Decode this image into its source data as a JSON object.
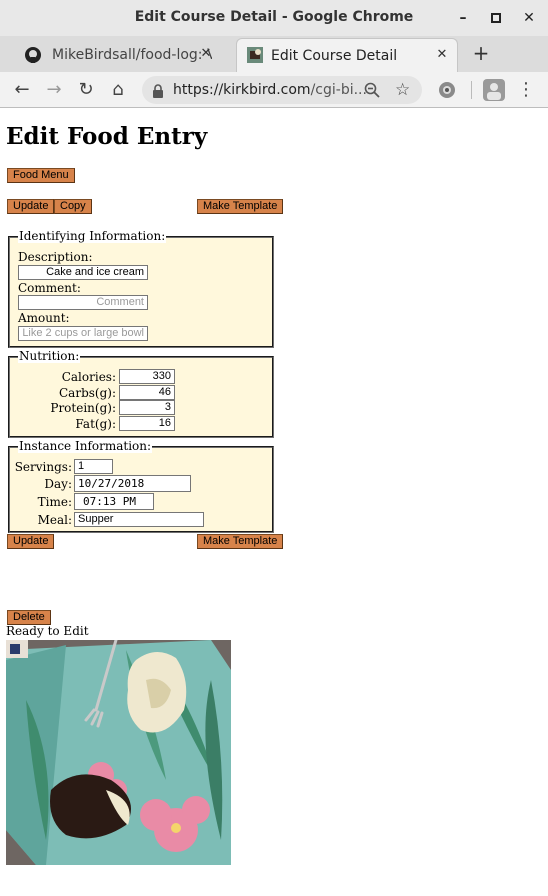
{
  "window": {
    "title": "Edit Course Detail - Google Chrome",
    "minimize": "–",
    "maximize": "▫",
    "close": "✕"
  },
  "tabs": [
    {
      "label": "MikeBirdsall/food-log: V",
      "close": "✕"
    },
    {
      "label": "Edit Course Detail",
      "close": "✕"
    }
  ],
  "toolbar": {
    "new_tab": "+",
    "back": "←",
    "forward": "→",
    "reload": "↻",
    "home": "⌂",
    "url_host": "https://kirkbird.com",
    "url_path": "/cgi-bi...",
    "star": "☆",
    "menu": "⋮"
  },
  "page": {
    "heading": "Edit Food Entry",
    "food_menu_button": "Food Menu",
    "update_button": "Update",
    "copy_button": "Copy",
    "make_template_button": "Make Template",
    "identifying": {
      "legend": "Identifying Information:",
      "description_label": "Description:",
      "description_value": "Cake and ice cream",
      "comment_label": "Comment:",
      "comment_placeholder": "Comment",
      "amount_label": "Amount:",
      "amount_placeholder": "Like 2 cups or large bowl"
    },
    "nutrition": {
      "legend": "Nutrition:",
      "calories_label": "Calories:",
      "calories_value": "330",
      "carbs_label": "Carbs(g):",
      "carbs_value": "46",
      "protein_label": "Protein(g):",
      "protein_value": "3",
      "fat_label": "Fat(g):",
      "fat_value": "16"
    },
    "instance": {
      "legend": "Instance Information:",
      "servings_label": "Servings:",
      "servings_value": "1",
      "day_label": "Day:",
      "day_value": "10/27/2018",
      "time_label": "Time:",
      "time_value": "07:13 PM",
      "meal_label": "Meal:",
      "meal_value": "Supper"
    },
    "update_button_bottom": "Update",
    "make_template_button_bottom": "Make Template",
    "delete_button": "Delete",
    "status": "Ready to Edit"
  },
  "colors": {
    "button": "#d7834a",
    "fieldset_bg": "#fff8dc"
  }
}
